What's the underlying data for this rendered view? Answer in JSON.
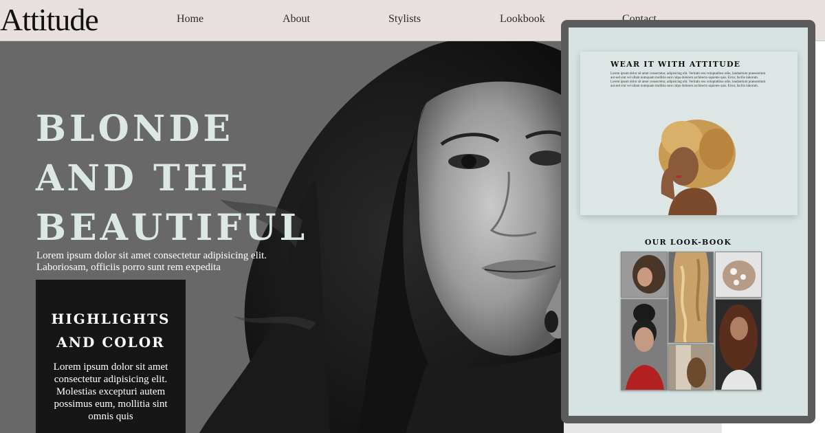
{
  "header": {
    "logo": "Attitude",
    "nav": [
      "Home",
      "About",
      "Stylists",
      "Lookbook",
      "Contact"
    ]
  },
  "hero": {
    "title_lines": [
      "BLONDE",
      "AND THE",
      "BEAUTIFUL"
    ],
    "subtitle": "Lorem ipsum dolor sit amet consectetur adipisicing elit. Laboriosam, officiis porro sunt rem expedita",
    "highlight": {
      "title_lines": [
        "HIGHLIGHTS",
        "AND COLOR"
      ],
      "text": "Lorem ipsum dolor sit amet consectetur adipisicing elit. Molestias excepturi autem possimus eum, mollitia sint omnis quis"
    }
  },
  "preview": {
    "card_title": "WEAR IT WITH ATTITUDE",
    "card_text": "Lorem ipsum dolor sit amet consectetur, adipisicing elit. Veritatis eos voluptatibus odio, laudantium praesentium aut sed sint vel ullam numquam mollitia sunt culpa dolorem architecto sapiente quis. Error, facilis laborum. Lorem ipsum dolor sit amet consectetur, adipisicing elit. Veritatis eos voluptatibus odio, laudantium praesentium aut sed sint vel ullam numquam mollitia sunt culpa dolorem architecto sapiente quis. Error, facilis laborum.",
    "lookbook_title": "OUR LOOK-BOOK"
  },
  "colors": {
    "header_bg": "#e8e0df",
    "hero_title": "#dbe8e4",
    "highlight_bg": "#161616",
    "frame": "#5b5b5b",
    "preview_bg": "#d6e3e2"
  }
}
